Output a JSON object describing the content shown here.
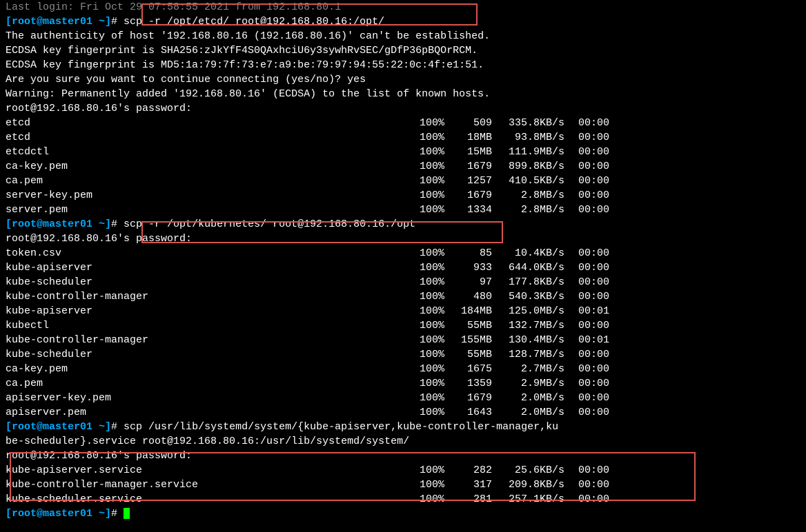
{
  "topLine": "Last login: Fri Oct 29 07:58:55 2021 from 192.168.80.1",
  "prompt": "[root@master01 ~]",
  "hash": "# ",
  "cmd1": "scp -r /opt/etcd/ root@192.168.80.16:/opt/",
  "auth": "The authenticity of host '192.168.80.16 (192.168.80.16)' can't be established.",
  "ecdsa1": "ECDSA key fingerprint is SHA256:zJkYfF4S0QAxhciU6y3sywhRvSEC/gDfP36pBQOrRCM.",
  "ecdsa2": "ECDSA key fingerprint is MD5:1a:79:7f:73:e7:a9:be:79:97:94:55:22:0c:4f:e1:51.",
  "sure": "Are you sure you want to continue connecting (yes/no)? yes",
  "warn": "Warning: Permanently added '192.168.80.16' (ECDSA) to the list of known hosts.",
  "passPrompt": "root@192.168.80.16's password:",
  "files1": [
    {
      "name": "etcd",
      "pct": "100%",
      "size": "509",
      "speed": "335.8KB/s",
      "time": "00:00"
    },
    {
      "name": "etcd",
      "pct": "100%",
      "size": "18MB",
      "speed": "93.8MB/s",
      "time": "00:00"
    },
    {
      "name": "etcdctl",
      "pct": "100%",
      "size": "15MB",
      "speed": "111.9MB/s",
      "time": "00:00"
    },
    {
      "name": "ca-key.pem",
      "pct": "100%",
      "size": "1679",
      "speed": "899.8KB/s",
      "time": "00:00"
    },
    {
      "name": "ca.pem",
      "pct": "100%",
      "size": "1257",
      "speed": "410.5KB/s",
      "time": "00:00"
    },
    {
      "name": "server-key.pem",
      "pct": "100%",
      "size": "1679",
      "speed": "2.8MB/s",
      "time": "00:00"
    },
    {
      "name": "server.pem",
      "pct": "100%",
      "size": "1334",
      "speed": "2.8MB/s",
      "time": "00:00"
    }
  ],
  "cmd2": "scp -r /opt/kubernetes/ root@192.168.80.16:/opt",
  "files2": [
    {
      "name": "token.csv",
      "pct": "100%",
      "size": "85",
      "speed": "10.4KB/s",
      "time": "00:00"
    },
    {
      "name": "kube-apiserver",
      "pct": "100%",
      "size": "933",
      "speed": "644.0KB/s",
      "time": "00:00"
    },
    {
      "name": "kube-scheduler",
      "pct": "100%",
      "size": "97",
      "speed": "177.8KB/s",
      "time": "00:00"
    },
    {
      "name": "kube-controller-manager",
      "pct": "100%",
      "size": "480",
      "speed": "540.3KB/s",
      "time": "00:00"
    },
    {
      "name": "kube-apiserver",
      "pct": "100%",
      "size": "184MB",
      "speed": "125.0MB/s",
      "time": "00:01"
    },
    {
      "name": "kubectl",
      "pct": "100%",
      "size": "55MB",
      "speed": "132.7MB/s",
      "time": "00:00"
    },
    {
      "name": "kube-controller-manager",
      "pct": "100%",
      "size": "155MB",
      "speed": "130.4MB/s",
      "time": "00:01"
    },
    {
      "name": "kube-scheduler",
      "pct": "100%",
      "size": "55MB",
      "speed": "128.7MB/s",
      "time": "00:00"
    },
    {
      "name": "ca-key.pem",
      "pct": "100%",
      "size": "1675",
      "speed": "2.7MB/s",
      "time": "00:00"
    },
    {
      "name": "ca.pem",
      "pct": "100%",
      "size": "1359",
      "speed": "2.9MB/s",
      "time": "00:00"
    },
    {
      "name": "apiserver-key.pem",
      "pct": "100%",
      "size": "1679",
      "speed": "2.0MB/s",
      "time": "00:00"
    },
    {
      "name": "apiserver.pem",
      "pct": "100%",
      "size": "1643",
      "speed": "2.0MB/s",
      "time": "00:00"
    }
  ],
  "cmd3a": "scp /usr/lib/systemd/system/{kube-apiserver,kube-controller-manager,ku",
  "cmd3b": "be-scheduler}.service root@192.168.80.16:/usr/lib/systemd/system/",
  "files3": [
    {
      "name": "kube-apiserver.service",
      "pct": "100%",
      "size": "282",
      "speed": "25.6KB/s",
      "time": "00:00"
    },
    {
      "name": "kube-controller-manager.service",
      "pct": "100%",
      "size": "317",
      "speed": "209.8KB/s",
      "time": "00:00"
    },
    {
      "name": "kube-scheduler.service",
      "pct": "100%",
      "size": "281",
      "speed": "257.1KB/s",
      "time": "00:00"
    }
  ]
}
